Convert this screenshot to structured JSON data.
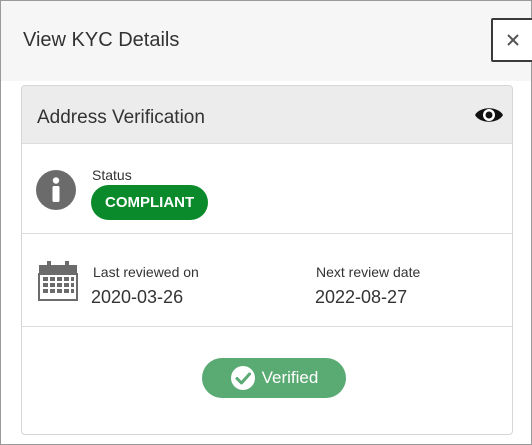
{
  "dialog": {
    "title": "View KYC Details",
    "close_label": "×"
  },
  "card": {
    "title": "Address Verification",
    "status": {
      "label": "Status",
      "value": "COMPLIANT"
    },
    "review": {
      "last_label": "Last reviewed on",
      "last_value": "2020-03-26",
      "next_label": "Next review date",
      "next_value": "2022-08-27"
    },
    "verification": {
      "label": "Verified"
    }
  },
  "colors": {
    "compliant_badge": "#0a8a2a",
    "verified_badge": "#5aaa73",
    "icon_gray": "#6b6b6b"
  },
  "icons": {
    "close": "close-icon",
    "eye": "eye-icon",
    "info": "info-icon",
    "calendar": "calendar-icon",
    "check": "check-circle-icon"
  }
}
